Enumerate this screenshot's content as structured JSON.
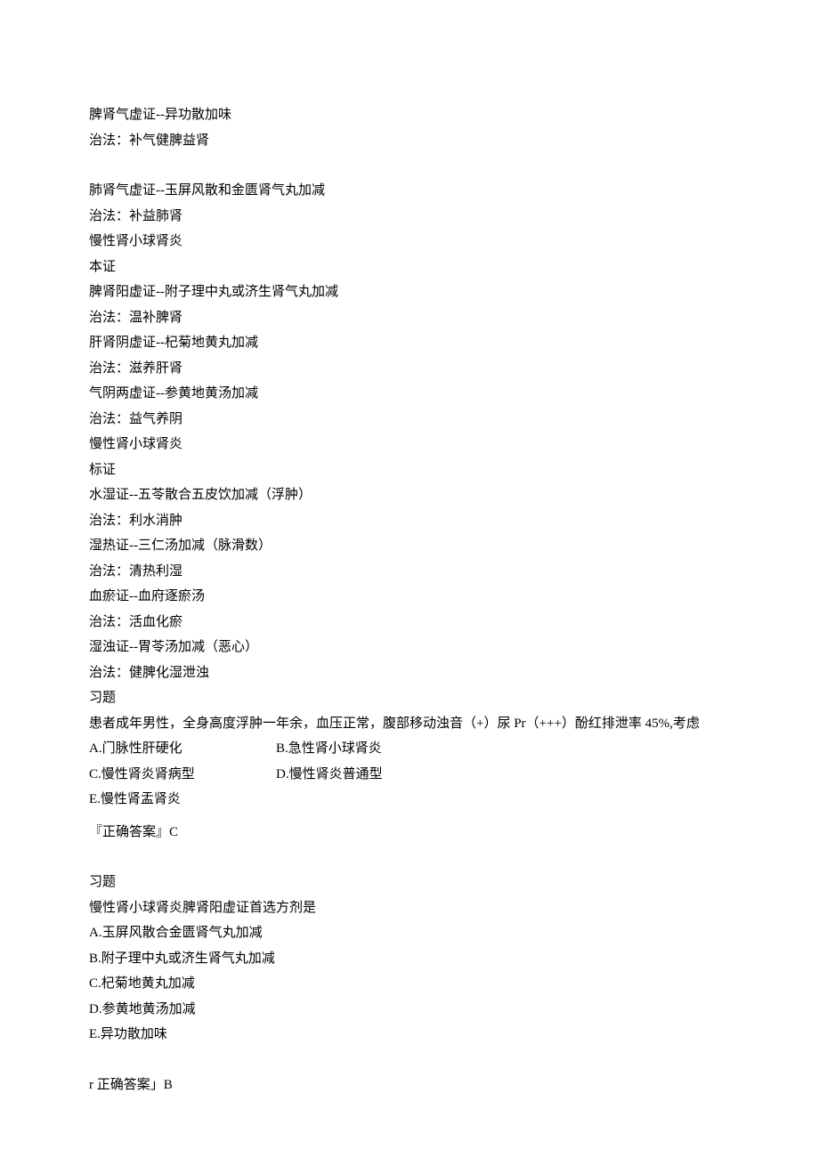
{
  "block1": {
    "l1": "脾肾气虚证--异功散加味",
    "l2": "治法：补气健脾益肾"
  },
  "block2": {
    "l1": "肺肾气虚证--玉屏风散和金匮肾气丸加减",
    "l2": "治法：补益肺肾",
    "l3": "慢性肾小球肾炎",
    "l4": "本证",
    "l5": "脾肾阳虚证--附子理中丸或济生肾气丸加减",
    "l6": "治法：温补脾肾",
    "l7": "肝肾阴虚证--杞菊地黄丸加减",
    "l8": "治法：滋养肝肾",
    "l9": "气阴两虚证--参黄地黄汤加减",
    "l10": "治法：益气养阴",
    "l11": "慢性肾小球肾炎",
    "l12": "标证",
    "l13": "水湿证--五苓散合五皮饮加减（浮肿）",
    "l14": "治法：利水消肿",
    "l15": "湿热证--三仁汤加减（脉滑数）",
    "l16": "治法：清热利湿",
    "l17": "血瘀证--血府逐瘀汤",
    "l18": "治法：活血化瘀",
    "l19": "湿浊证--胃苓汤加减（恶心）",
    "l20": "治法：健脾化湿泄浊"
  },
  "q1": {
    "title": "习题",
    "stem": "患者成年男性，全身高度浮肿一年余，血压正常，腹部移动浊音（+）尿 Pr（+++）酚红排泄率 45%,考虑",
    "optA": "A.门脉性肝硬化",
    "optB": "B.急性肾小球肾炎",
    "optC": "C.慢性肾炎肾病型",
    "optD": "D.慢性肾炎普通型",
    "optE": "E.慢性肾盂肾炎",
    "answer": "『正确答案』C"
  },
  "q2": {
    "title": "习题",
    "stem": "慢性肾小球肾炎脾肾阳虚证首选方剂是",
    "optA": "A.玉屏风散合金匮肾气丸加减",
    "optB": "B.附子理中丸或济生肾气丸加减",
    "optC": "C.杞菊地黄丸加减",
    "optD": "D.参黄地黄汤加减",
    "optE": "E.异功散加味",
    "answer": "r 正确答案」B"
  }
}
